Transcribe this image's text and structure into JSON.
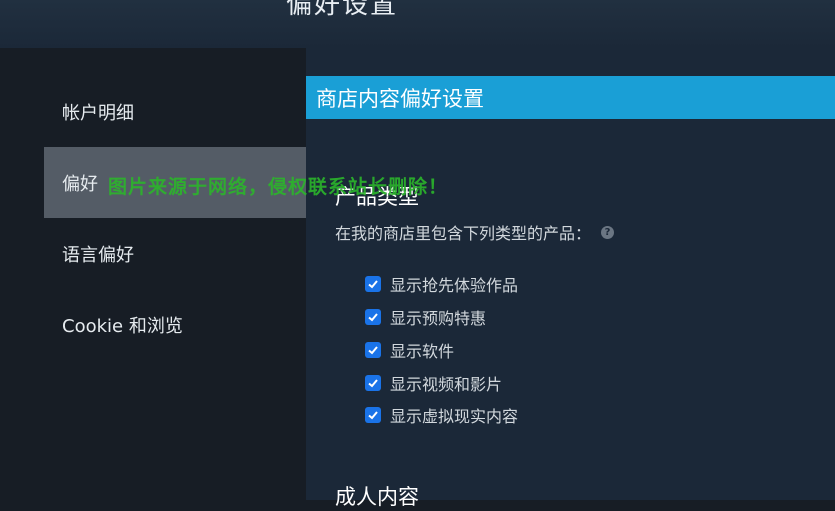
{
  "header": {
    "title": "偏好设置"
  },
  "sidebar": {
    "items": [
      {
        "label": "帐户明细",
        "active": false
      },
      {
        "label": "偏好",
        "active": true
      },
      {
        "label": "语言偏好",
        "active": false
      },
      {
        "label": "Cookie 和浏览",
        "active": false
      }
    ]
  },
  "main": {
    "section_title": "商店内容偏好设置",
    "product_types": {
      "heading": "产品类型",
      "description": "在我的商店里包含下列类型的产品：",
      "help_icon": "?",
      "options": [
        {
          "label": "显示抢先体验作品",
          "checked": true
        },
        {
          "label": "显示预购特惠",
          "checked": true
        },
        {
          "label": "显示软件",
          "checked": true
        },
        {
          "label": "显示视频和影片",
          "checked": true
        },
        {
          "label": "显示虚拟现实内容",
          "checked": true
        }
      ]
    },
    "adult_content": {
      "heading": "成人内容"
    }
  },
  "watermark": "图片来源于网络，侵权联系站长删除！",
  "colors": {
    "accent": "#1a9fd6",
    "checkbox": "#1a73e8",
    "active_nav": "#545c66",
    "watermark": "#2bb52b"
  }
}
